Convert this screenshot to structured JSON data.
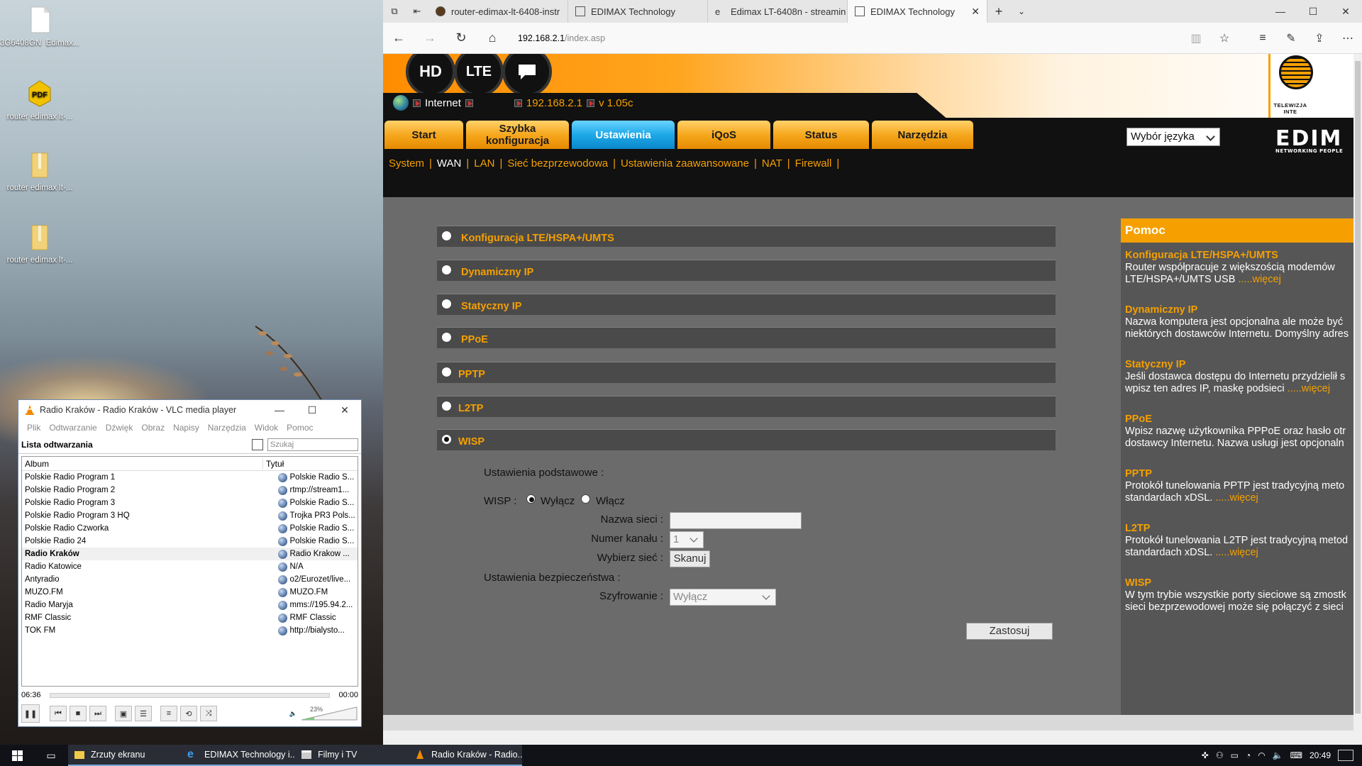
{
  "desktop": {
    "icons": [
      {
        "label": "3G6408GN_Edimax...",
        "icon": "file-icon"
      },
      {
        "label": "router edimax lt-...",
        "icon": "pdf-icon"
      },
      {
        "label": "router edimax lt-...",
        "icon": "zip-folder-icon"
      },
      {
        "label": "router edimax lt-...",
        "icon": "folder-icon"
      }
    ]
  },
  "vlc": {
    "title": "Radio Kraków - Radio Kraków - VLC media player",
    "menu": [
      "Plik",
      "Odtwarzanie",
      "Dźwięk",
      "Obraz",
      "Napisy",
      "Narzędzia",
      "Widok",
      "Pomoc"
    ],
    "playlist_label": "Lista odtwarzania",
    "search_placeholder": "Szukaj",
    "columns": {
      "album": "Album",
      "title": "Tytuł"
    },
    "rows": [
      {
        "album": "Polskie Radio Program 1",
        "title": "Polskie Radio S..."
      },
      {
        "album": "Polskie Radio Program 2",
        "title": "rtmp://stream1..."
      },
      {
        "album": "Polskie Radio Program 3",
        "title": "Polskie Radio S..."
      },
      {
        "album": "Polskie Radio Program 3 HQ",
        "title": "Trojka PR3 Pols..."
      },
      {
        "album": "Polskie Radio Czworka",
        "title": "Polskie Radio S..."
      },
      {
        "album": "Polskie Radio 24",
        "title": "Polskie Radio S..."
      },
      {
        "album": "Radio Kraków",
        "title": "Radio Krakow ..."
      },
      {
        "album": "Radio Katowice",
        "title": "N/A"
      },
      {
        "album": "Antyradio",
        "title": "o2/Eurozet/live..."
      },
      {
        "album": "MUZO.FM",
        "title": "MUZO.FM"
      },
      {
        "album": "Radio Maryja",
        "title": "mms://195.94.2..."
      },
      {
        "album": "RMF Classic",
        "title": "RMF Classic"
      },
      {
        "album": "TOK FM",
        "title": "http://bialysto..."
      }
    ],
    "current_index": 6,
    "elapsed": "06:36",
    "total": "00:00",
    "volume": "23%"
  },
  "browser": {
    "tabs": [
      {
        "label": "router-edimax-lt-6408-instr"
      },
      {
        "label": "EDIMAX Technology"
      },
      {
        "label": "Edimax LT-6408n - streamin"
      },
      {
        "label": "EDIMAX Technology"
      }
    ],
    "url_host": "192.168.2.1",
    "url_path": "/index.asp"
  },
  "router": {
    "badges": [
      "HD",
      "LTE",
      ""
    ],
    "status": {
      "internet": "Internet",
      "ip": "192.168.2.1",
      "version": "v 1.05c"
    },
    "nav": [
      "Start",
      "Szybka konfiguracja",
      "Ustawienia",
      "iQoS",
      "Status",
      "Narzędzia"
    ],
    "language": "Wybór języka",
    "brand": "EDIM",
    "brand_sub": "NETWORKING PEOPLE",
    "logo_text": "TELEWIZJA INTE",
    "subnav": [
      "System",
      "WAN",
      "LAN",
      "Sieć bezprzewodowa",
      "Ustawienia zaawansowane",
      "NAT",
      "Firewall"
    ],
    "options": [
      "Konfiguracja LTE/HSPA+/UMTS",
      "Dynamiczny IP",
      "Statyczny IP",
      "PPoE",
      "PPTP",
      "L2TP",
      "WISP"
    ],
    "selected_option": "WISP",
    "form": {
      "basic_label": "Ustawienia podstawowe :",
      "wisp_label": "WISP :",
      "wisp_off": "Wyłącz",
      "wisp_on": "Włącz",
      "ssid_label": "Nazwa sieci :",
      "channel_label": "Numer kanału :",
      "channel_value": "1",
      "scan_label": "Wybierz sieć :",
      "scan_button": "Skanuj",
      "security_label": "Ustawienia bezpieczeństwa :",
      "encryption_label": "Szyfrowanie :",
      "encryption_value": "Wyłącz",
      "apply": "Zastosuj"
    },
    "help": {
      "title": "Pomoc",
      "items": [
        {
          "head": "Konfiguracja LTE/HSPA+/UMTS",
          "l1": "Router współpracuje z większością modemów",
          "l2": "LTE/HSPA+/UMTS USB",
          "more": ".....więcej"
        },
        {
          "head": "Dynamiczny IP",
          "l1": "Nazwa komputera jest opcjonalna ale może być",
          "l2": "niektórych dostawców Internetu. Domyślny adres",
          "more": ""
        },
        {
          "head": "Statyczny IP",
          "l1": "Jeśli dostawca dostępu do Internetu przydzielił s",
          "l2": "wpisz ten adres IP, maskę podsieci",
          "more": ".....więcej"
        },
        {
          "head": "PPoE",
          "l1": "Wpisz nazwę użytkownika PPPoE oraz hasło otr",
          "l2": "dostawcy Internetu. Nazwa usługi jest opcjonaln",
          "more": ""
        },
        {
          "head": "PPTP",
          "l1": "Protokół tunelowania PPTP jest tradycyjną meto",
          "l2": "standardach xDSL.",
          "more": ".....więcej"
        },
        {
          "head": "L2TP",
          "l1": "Protokół tunelowania L2TP jest tradycyjną metod",
          "l2": "standardach xDSL.",
          "more": ".....więcej"
        },
        {
          "head": "WISP",
          "l1": "W tym trybie wszystkie porty sieciowe są zmostk",
          "l2": "sieci bezprzewodowej może się połączyć z sieci",
          "more": ""
        }
      ]
    }
  },
  "taskbar": {
    "items": [
      {
        "label": "Zrzuty ekranu"
      },
      {
        "label": "EDIMAX Technology i..."
      },
      {
        "label": "Filmy i TV"
      },
      {
        "label": "Radio Kraków - Radio..."
      }
    ],
    "time": "20:49"
  },
  "colors": {
    "accent": "#f5a000",
    "active_tab": "#1ea8e8",
    "content_bg": "#6b6b6b"
  }
}
